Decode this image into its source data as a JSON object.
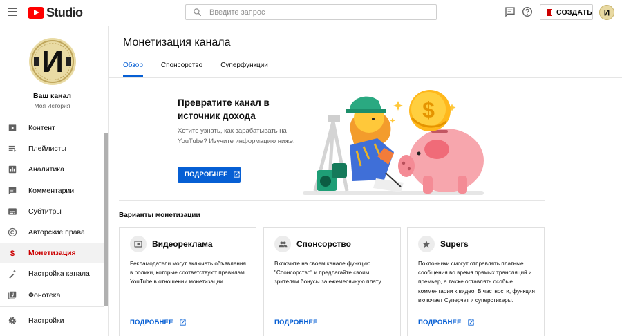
{
  "header": {
    "logo_text": "Studio",
    "search_placeholder": "Введите запрос",
    "create_label": "СОЗДАТЬ",
    "avatar_letter": "И"
  },
  "sidebar": {
    "channel_name": "Ваш канал",
    "channel_subtitle": "Моя История",
    "items": [
      {
        "label": "Контент",
        "icon": "video-content-icon"
      },
      {
        "label": "Плейлисты",
        "icon": "playlist-icon"
      },
      {
        "label": "Аналитика",
        "icon": "analytics-icon"
      },
      {
        "label": "Комментарии",
        "icon": "comments-icon"
      },
      {
        "label": "Субтитры",
        "icon": "subtitles-icon"
      },
      {
        "label": "Авторские права",
        "icon": "copyright-icon"
      },
      {
        "label": "Монетизация",
        "icon": "dollar-icon"
      },
      {
        "label": "Настройка канала",
        "icon": "magic-wand-icon"
      },
      {
        "label": "Фонотека",
        "icon": "audio-library-icon"
      }
    ],
    "active_index": 6,
    "settings_label": "Настройки"
  },
  "main": {
    "title": "Монетизация канала",
    "tabs": [
      {
        "label": "Обзор",
        "active": true
      },
      {
        "label": "Спонсорство",
        "active": false
      },
      {
        "label": "Суперфункции",
        "active": false
      }
    ],
    "promo": {
      "title": "Превратите канал в источник дохода",
      "description": "Хотите узнать, как зарабатывать на YouTube? Изучите информацию ниже.",
      "button_label": "ПОДРОБНЕЕ"
    },
    "section_title": "Варианты монетизации",
    "cards": [
      {
        "title": "Видеореклама",
        "icon": "ad-video-icon",
        "description": "Рекламодатели могут включать объявления в ролики, которые соответствуют правилам YouTube в отношении монетизации.",
        "link_label": "ПОДРОБНЕЕ"
      },
      {
        "title": "Спонсорство",
        "icon": "people-icon",
        "description": "Включите на своем канале функцию \"Спонсорство\" и предлагайте своим зрителям бонусы за ежемесячную плату.",
        "link_label": "ПОДРОБНЕЕ"
      },
      {
        "title": "Supers",
        "icon": "star-icon",
        "description": "Поклонники смогут отправлять платные сообщения во время прямых трансляций и премьер, а также оставлять особые комментарии к видео. В частности, функция включает Суперчат и суперстикеры.",
        "link_label": "ПОДРОБНЕЕ"
      }
    ]
  },
  "colors": {
    "brand_red": "#ff0000",
    "accent_blue": "#065fd4",
    "active_red": "#cc0000"
  }
}
